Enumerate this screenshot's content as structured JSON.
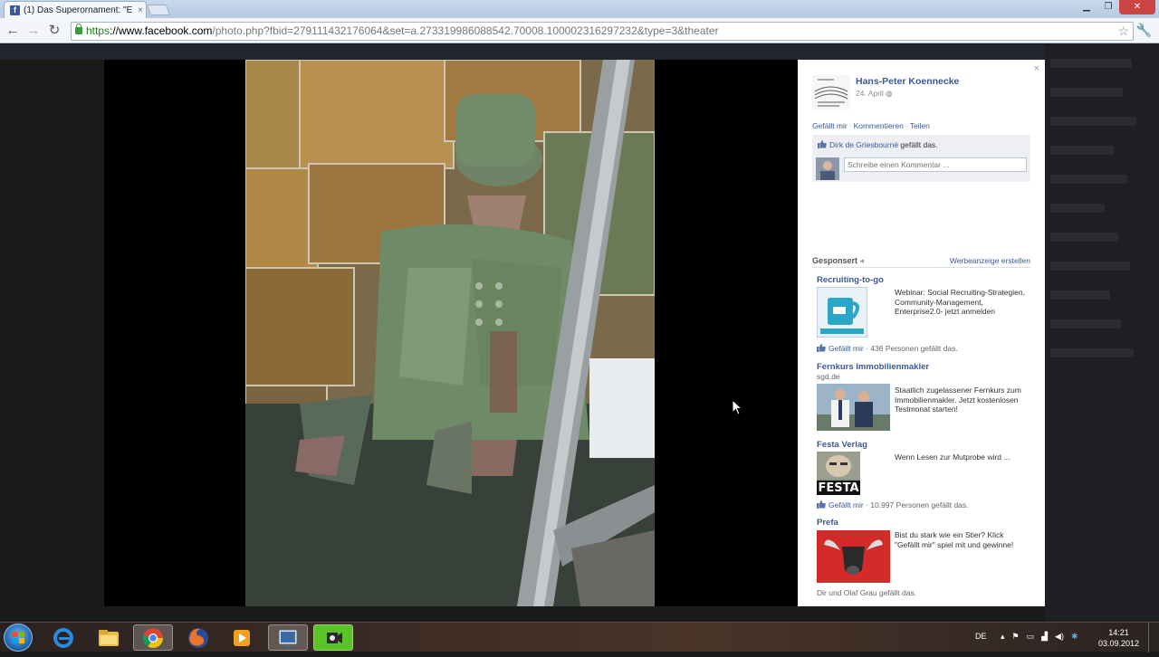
{
  "browser": {
    "tab_title": "(1) Das Superornament: \"E",
    "tab_icon_letter": "f",
    "tab_close": "×",
    "url_https": "https",
    "url_domain": "://www.facebook.com",
    "url_path": "/photo.php?fbid=279111432176064&set=a.273319986088542.70008.100002316297232&type=3&theater"
  },
  "panel": {
    "close": "×",
    "owner_name": "Hans-Peter Koennecke",
    "owner_date": "24. April",
    "actions": [
      "Gefällt mir",
      "Kommentieren",
      "Teilen"
    ],
    "liker_name": "Dirk de Griesbourné",
    "liker_suffix": " gefällt das.",
    "comment_placeholder": "Schreibe einen Kommentar ...",
    "sponsored_label": "Gesponsert",
    "create_ad": "Werbeanzeige erstellen"
  },
  "ads": [
    {
      "title": "Recruiting-to-go",
      "body": "Webinar: Social Recruiting-Strategien, Community-Management, Enterprise2.0- jetzt anmelden",
      "like_link": "Gefällt mir",
      "like_text": " · 436 Personen gefällt das."
    },
    {
      "title": "Fernkurs Immobilienmakler",
      "sub": "sgd.de",
      "body": "Staatlich zugelassener Fernkurs zum Immobilienmakler. Jetzt kostenlosen Testmonat starten!"
    },
    {
      "title": "Festa Verlag",
      "body": "Wenn Lesen zur Mutprobe wird ...",
      "img_text": "FESTA",
      "like_link": "Gefällt mir",
      "like_text": " · 10.997 Personen gefällt das."
    },
    {
      "title": "Prefa",
      "body": "Bist du stark wie ein Stier? Klick \"Gefällt mir\" spiel mit und gewinne!",
      "like_text": "Dir und Olaf Grau gefällt das."
    }
  ],
  "taskbar": {
    "language": "DE",
    "time": "14:21",
    "date": "03.09.2012"
  },
  "colors": {
    "fb_blue": "#3b5998",
    "https_green": "#1f7a1f"
  }
}
